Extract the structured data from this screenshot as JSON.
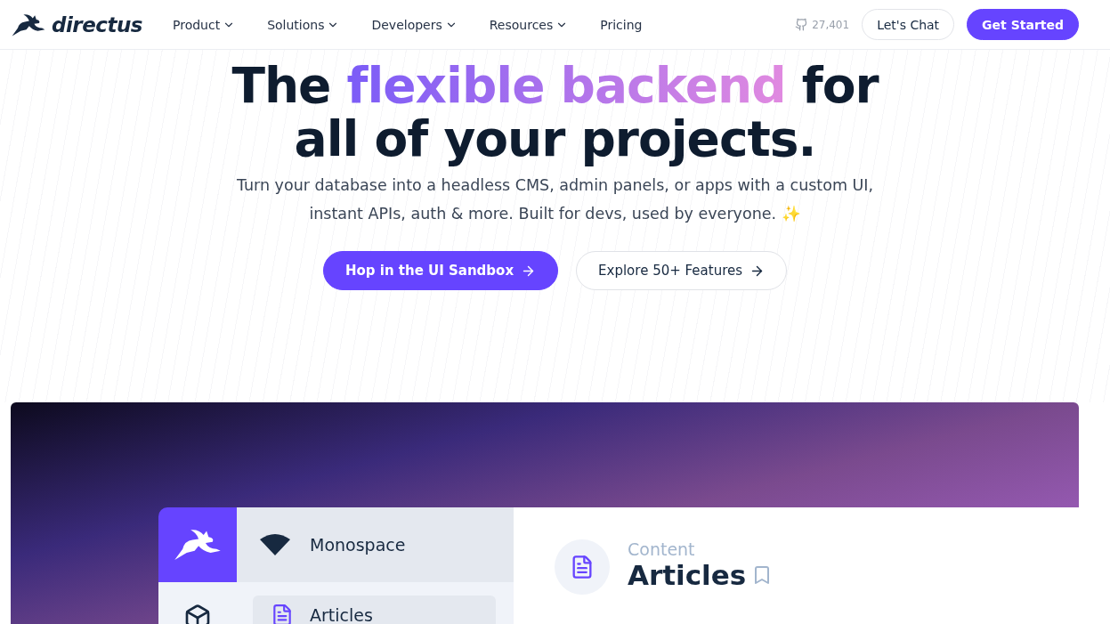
{
  "nav": {
    "brand": "directus",
    "items": [
      {
        "label": "Product",
        "dropdown": true
      },
      {
        "label": "Solutions",
        "dropdown": true
      },
      {
        "label": "Developers",
        "dropdown": true
      },
      {
        "label": "Resources",
        "dropdown": true
      },
      {
        "label": "Pricing",
        "dropdown": false
      }
    ],
    "stars": "27,401",
    "chat_button": "Let's Chat",
    "cta_button": "Get Started"
  },
  "hero": {
    "title_before": "The ",
    "title_highlight": "flexible backend",
    "title_after": " for",
    "title_line2": "all of your projects.",
    "subtitle": "Turn your database into a headless CMS, admin panels, or apps with a custom UI, instant APIs, auth & more. Built for devs, used by everyone. ✨",
    "buttons": [
      {
        "label": "Hop in the UI Sandbox",
        "kind": "primary"
      },
      {
        "label": "Explore 50+ Features",
        "kind": "secondary"
      }
    ]
  },
  "preview": {
    "project": "Monospace",
    "nav_items": [
      {
        "label": "Articles",
        "selected": true
      }
    ],
    "breadcrumb": "Content",
    "page_title": "Articles"
  }
}
